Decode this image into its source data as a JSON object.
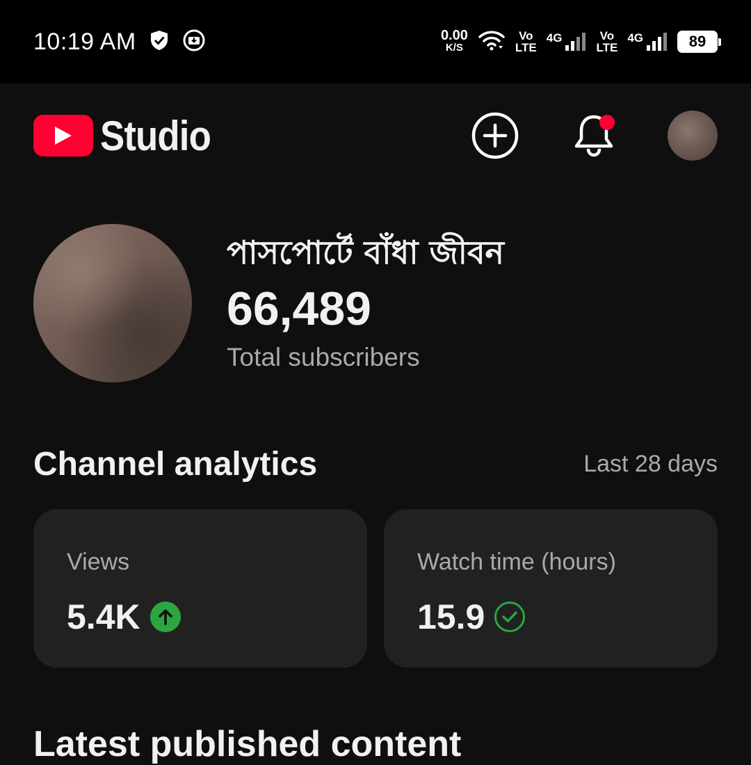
{
  "status_bar": {
    "time": "10:19 AM",
    "net_speed_value": "0.00",
    "net_speed_unit": "K/S",
    "volte1_top": "Vo",
    "volte1_bottom": "LTE",
    "sim1_net": "4G",
    "volte2_top": "Vo",
    "volte2_bottom": "LTE",
    "sim2_net": "4G",
    "battery": "89"
  },
  "app_bar": {
    "logo_text": "Studio",
    "brand_color": "#ff0033"
  },
  "channel": {
    "name": "পাসপোর্টে বাঁধা জীবন",
    "subscribers": "66,489",
    "subscribers_label": "Total subscribers"
  },
  "analytics": {
    "title": "Channel analytics",
    "period": "Last 28 days",
    "cards": [
      {
        "label": "Views",
        "value": "5.4K",
        "status_icon": "arrow-up-icon"
      },
      {
        "label": "Watch time (hours)",
        "value": "15.9",
        "status_icon": "check-circle-icon"
      }
    ],
    "positive_color": "#2ba640"
  },
  "latest": {
    "title": "Latest published content"
  }
}
